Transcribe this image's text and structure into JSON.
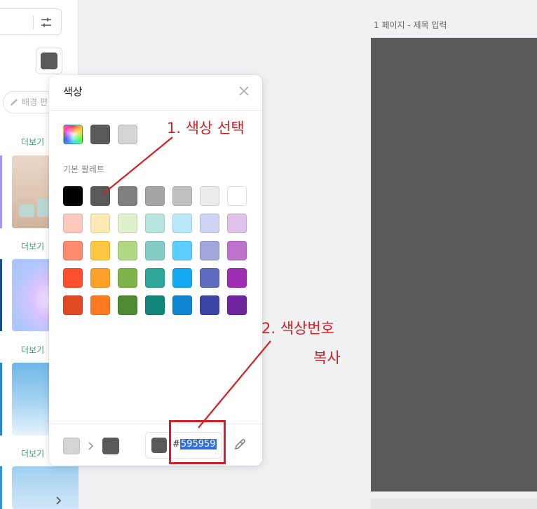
{
  "popup": {
    "title": "색상",
    "palette_label": "기본 팔레트",
    "recent_colors": [
      "#595959",
      "#d4d4d4"
    ],
    "palette_rows": [
      [
        "#000000",
        "#595959",
        "#7f7f7f",
        "#a5a5a5",
        "#c0c0c0",
        "#ececec",
        "#ffffff"
      ],
      [
        "#ffc8bd",
        "#ffe9b5",
        "#dff0cc",
        "#b8e5df",
        "#b9e8fb",
        "#cfd3f3",
        "#e0c1ea"
      ],
      [
        "#ff8a6e",
        "#ffc83e",
        "#b0d884",
        "#84ccc6",
        "#5ccdff",
        "#a0a7d8",
        "#bf72cb"
      ],
      [
        "#ff512f",
        "#ffa128",
        "#7fb44c",
        "#2fa79a",
        "#14a8f2",
        "#5e6cc0",
        "#9f2fb2"
      ],
      [
        "#e04a25",
        "#ff7a1e",
        "#4d8a32",
        "#11877a",
        "#0f86d1",
        "#3a44a2",
        "#6f24a0"
      ]
    ],
    "footer": {
      "from_color": "#d4d4d4",
      "to_color": "#595959",
      "hex_hash": "#",
      "hex_value": "595959"
    }
  },
  "sidebar": {
    "bg_edit_label": "배경 편",
    "more_label": "더보기",
    "current_color": "#595959"
  },
  "canvas": {
    "page_label": "1 페이지 - 제목 입력",
    "page_color": "#595959"
  },
  "annotations": {
    "step1": "1. 색상 선택",
    "step2_line1": "2. 색상번호",
    "step2_line2": "복사",
    "color": "#d31f26"
  }
}
